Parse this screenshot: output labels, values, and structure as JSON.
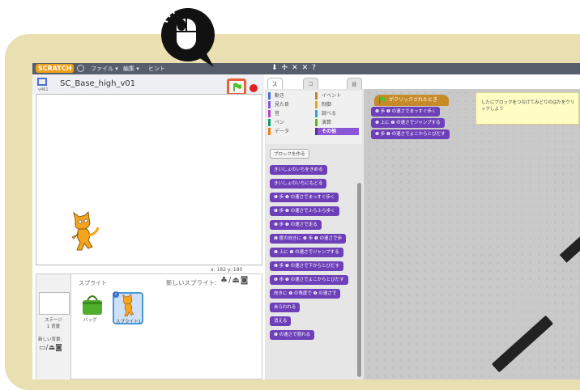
{
  "menu": {
    "logo": "SCRATCH",
    "file": "ファイル ▾",
    "edit": "編集 ▾",
    "hint": "ヒント"
  },
  "stage": {
    "project_title": "SC_Base_high_v01",
    "version": "v461",
    "coords": "x: 182  y: 180"
  },
  "sprites": {
    "title": "スプライト",
    "new_sprite": "新しいスプライト:",
    "stage_label": "ステージ",
    "stage_count": "1 背景",
    "new_backdrop": "新しい背景:",
    "items": [
      {
        "label": "バッグ"
      },
      {
        "label": "スプライト1"
      }
    ]
  },
  "tabs": [
    "スクリプト",
    "コスチューム",
    "音"
  ],
  "categories": [
    {
      "label": "動き",
      "color": "#4a6cd4"
    },
    {
      "label": "見た目",
      "color": "#8a55d7"
    },
    {
      "label": "音",
      "color": "#bb42c3"
    },
    {
      "label": "ペン",
      "color": "#0e9a6c"
    },
    {
      "label": "データ",
      "color": "#ee7d16"
    },
    {
      "label": "イベント",
      "color": "#c88330"
    },
    {
      "label": "制御",
      "color": "#e1a91a"
    },
    {
      "label": "調べる",
      "color": "#2ca5e2"
    },
    {
      "label": "演算",
      "color": "#5cb712"
    },
    {
      "label": "その他",
      "color": "#632d99"
    }
  ],
  "palette": {
    "make_block": "ブロックを作る",
    "blocks": [
      "きいしょのいちをきめる",
      "きいしょのいちにもどる",
      "❶ 歩 ❶ の速さでまっすぐ歩く",
      "❶ 歩 ❶ の速さでふらふら歩く",
      "❶ 歩 ❶ の速さで走る",
      "❶ 度の向きに ❶ 歩 ❶ の速さで歩",
      "❶ 上に ❶ の速さでジャンプする",
      "❶ 歩 ❶ の速さで下からとびだす",
      "❶ 歩 ❶ の速さでよこからとびだす",
      "向きに ❶ の角度で ❶ の速さで",
      "あらわれる",
      "消える",
      "❶ の速さで隠れる"
    ]
  },
  "script": {
    "hat": "がクリックされたとき",
    "blocks": [
      "❶ 歩 ❶ の速さでまっすぐ歩く",
      "❶ 上に ❶ の速さでジャンプする",
      "❶ 歩 ❶ の速さでよこからとびだす"
    ],
    "note": "したにブロックをつなげてみどりのはたをクリックしよう"
  },
  "colors": {
    "accent": "#e8623a",
    "motion_purple": "#6d3fb8",
    "event_orange": "#c68a29",
    "frame_beige": "#e9dfb0"
  },
  "icons": [
    "mouse-icon",
    "green-flag-icon",
    "stop-icon",
    "globe-icon",
    "cat-sprite-icon",
    "bag-sprite-icon",
    "paint-icon",
    "camera-icon",
    "upload-icon"
  ]
}
